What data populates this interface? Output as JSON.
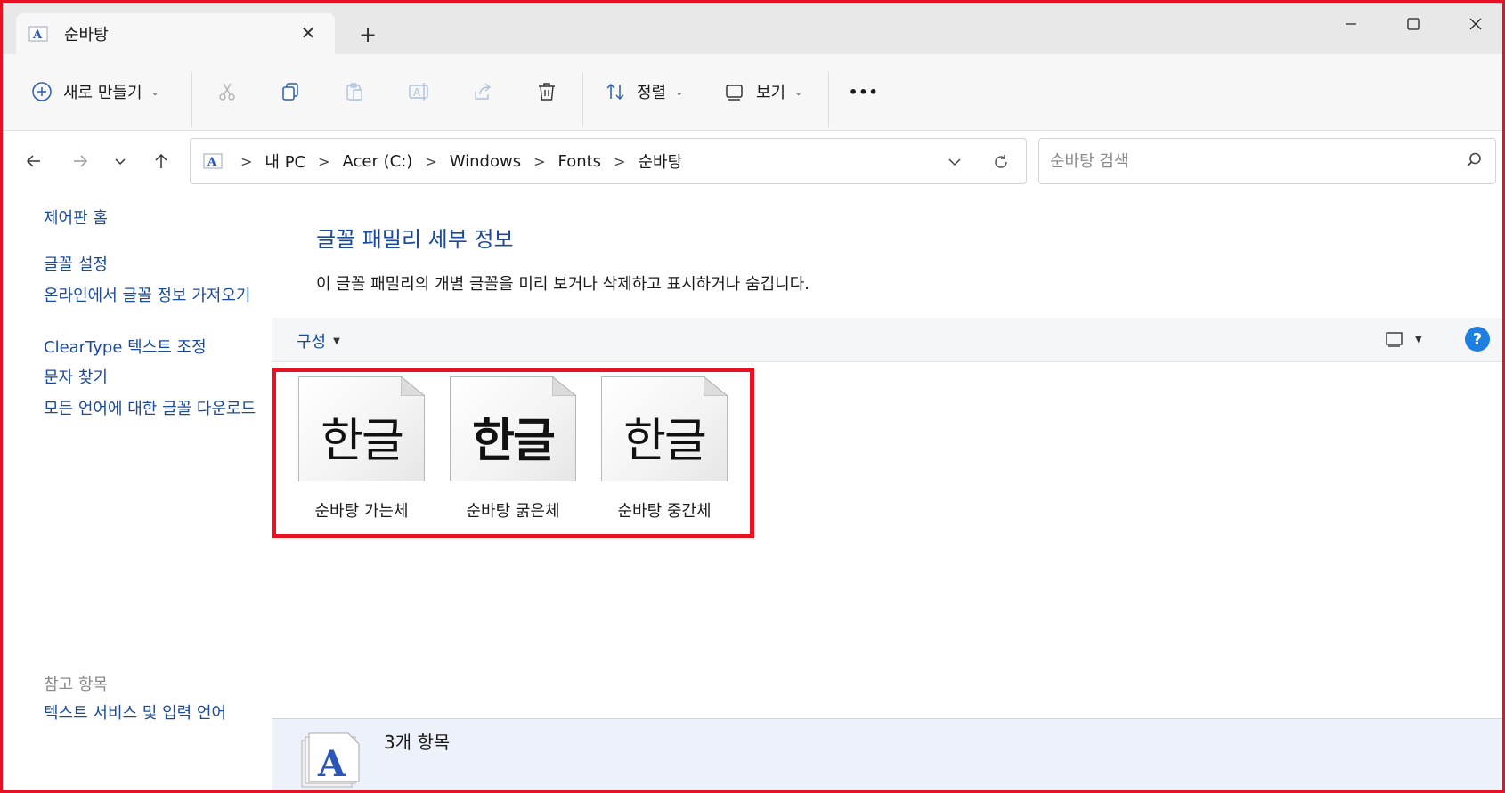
{
  "window": {
    "tab_title": "순바탕",
    "tab_close": "✕",
    "new_tab": "+"
  },
  "toolbar": {
    "new_label": "새로 만들기",
    "sort_label": "정렬",
    "view_label": "보기",
    "more_label": "•••"
  },
  "address": {
    "breadcrumbs": [
      "내 PC",
      "Acer (C:)",
      "Windows",
      "Fonts",
      "순바탕"
    ],
    "separator": ">"
  },
  "search": {
    "placeholder": "순바탕 검색"
  },
  "sidebar": {
    "links": [
      "제어판 홈",
      "글꼴 설정",
      "온라인에서 글꼴 정보 가져오기",
      "ClearType 텍스트 조정",
      "문자 찾기",
      "모든 언어에 대한 글꼴 다운로드"
    ],
    "see_also_heading": "참고 항목",
    "see_also_links": [
      "텍스트 서비스 및 입력 언어"
    ]
  },
  "main": {
    "title": "글꼴 패밀리 세부 정보",
    "description": "이 글꼴 패밀리의 개별 글꼴을 미리 보거나 삭제하고 표시하거나 숨깁니다.",
    "organize_label": "구성",
    "help_label": "?",
    "fonts": [
      {
        "name": "순바탕 가는체",
        "sample": "한글",
        "weight": "light"
      },
      {
        "name": "순바탕 굵은체",
        "sample": "한글",
        "weight": "bold"
      },
      {
        "name": "순바탕 중간체",
        "sample": "한글",
        "weight": "medium"
      }
    ]
  },
  "details": {
    "item_count": "3개 항목",
    "icon_letter": "A"
  },
  "colors": {
    "highlight_border": "#e81123",
    "link": "#1a4a9e",
    "help_button": "#1f7fe0"
  }
}
